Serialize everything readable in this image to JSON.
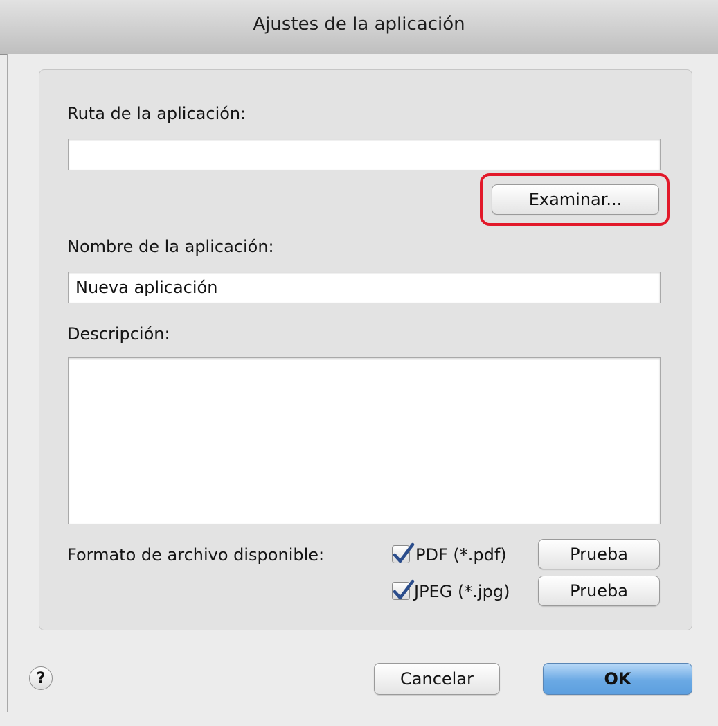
{
  "window": {
    "title": "Ajustes de la aplicación"
  },
  "app_path": {
    "label": "Ruta de la aplicación:",
    "value": "",
    "browse_label": "Examinar..."
  },
  "app_name": {
    "label": "Nombre de la aplicación:",
    "value": "Nueva aplicación"
  },
  "description": {
    "label": "Descripción:",
    "value": ""
  },
  "formats": {
    "label": "Formato de archivo disponible:",
    "items": [
      {
        "label": "PDF (*.pdf)",
        "checked": true,
        "test_label": "Prueba"
      },
      {
        "label": "JPEG (*.jpg)",
        "checked": true,
        "test_label": "Prueba"
      }
    ]
  },
  "footer": {
    "help_label": "?",
    "cancel_label": "Cancelar",
    "ok_label": "OK"
  },
  "colors": {
    "highlight": "#e2192a",
    "primary_button": "#6aa9e4"
  },
  "icons": {
    "help": "help-icon",
    "check": "checkmark-icon"
  }
}
